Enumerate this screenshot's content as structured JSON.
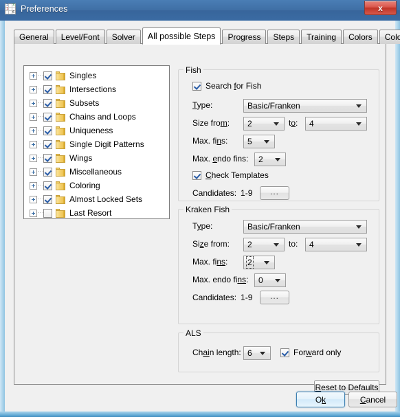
{
  "window": {
    "title": "Preferences",
    "icon": "sudoku-grid-icon",
    "close_label": "x",
    "titlebar_color": "#3f6fa5"
  },
  "tabs": [
    {
      "label": "General",
      "active": false
    },
    {
      "label": "Level/Font",
      "active": false
    },
    {
      "label": "Solver",
      "active": false
    },
    {
      "label": "All possible Steps",
      "active": true
    },
    {
      "label": "Progress",
      "active": false
    },
    {
      "label": "Steps",
      "active": false
    },
    {
      "label": "Training",
      "active": false
    },
    {
      "label": "Colors",
      "active": false
    },
    {
      "label": "ColorKu",
      "active": false
    }
  ],
  "tree": {
    "items": [
      {
        "label": "Singles",
        "checked": true,
        "expanded": false
      },
      {
        "label": "Intersections",
        "checked": true,
        "expanded": false
      },
      {
        "label": "Subsets",
        "checked": true,
        "expanded": false
      },
      {
        "label": "Chains and Loops",
        "checked": true,
        "expanded": false
      },
      {
        "label": "Uniqueness",
        "checked": true,
        "expanded": false
      },
      {
        "label": "Single Digit Patterns",
        "checked": true,
        "expanded": false
      },
      {
        "label": "Wings",
        "checked": true,
        "expanded": false
      },
      {
        "label": "Miscellaneous",
        "checked": true,
        "expanded": false
      },
      {
        "label": "Coloring",
        "checked": true,
        "expanded": false
      },
      {
        "label": "Almost Locked Sets",
        "checked": true,
        "expanded": false
      },
      {
        "label": "Last Resort",
        "checked": false,
        "expanded": false
      }
    ]
  },
  "fish": {
    "legend": "Fish",
    "search_label_pre": "Search ",
    "search_label_mnemonic": "f",
    "search_label_post": "or Fish",
    "search_checked": true,
    "type_label_pre": "",
    "type_label_mnemonic": "T",
    "type_label_post": "ype:",
    "type_value": "Basic/Franken",
    "size_label_pre": "Size fro",
    "size_label_mnemonic": "m",
    "size_label_post": ":",
    "size_from_value": "2",
    "to_label_pre": "t",
    "to_label_mnemonic": "o",
    "to_label_post": ":",
    "size_to_value": "4",
    "maxfins_label_pre": "Max. fi",
    "maxfins_label_mnemonic": "n",
    "maxfins_label_post": "s:",
    "maxfins_value": "5",
    "endofins_label_pre": "Max. ",
    "endofins_label_mnemonic": "e",
    "endofins_label_post": "ndo fins:",
    "endofins_value": "2",
    "templates_label_pre": "",
    "templates_label_mnemonic": "C",
    "templates_label_post": "heck Templates",
    "templates_checked": true,
    "candidates_label": "Candidates:",
    "candidates_value": "1-9",
    "candidates_button": "..."
  },
  "kraken": {
    "legend": "Kraken Fish",
    "type_label_pre": "T",
    "type_label_mnemonic": "y",
    "type_label_post": "pe:",
    "type_value": "Basic/Franken",
    "size_label_pre": "Si",
    "size_label_mnemonic": "z",
    "size_label_post": "e from:",
    "size_from_value": "2",
    "to_label": "to:",
    "size_to_value": "4",
    "maxfins_label_pre": "Max. fi",
    "maxfins_label_mnemonic": "ns",
    "maxfins_label_post": ":",
    "maxfins_value": "2",
    "maxfins_focused": true,
    "endofins_label_pre": "Max. endo fi",
    "endofins_label_mnemonic": "ns",
    "endofins_label_post": ":",
    "endofins_value": "0",
    "candidates_label": "Candidates:",
    "candidates_value": "1-9",
    "candidates_button": "..."
  },
  "als": {
    "legend": "ALS",
    "chain_label_pre": "Ch",
    "chain_label_mnemonic": "ai",
    "chain_label_post": "n length:",
    "chain_value": "6",
    "forward_label_pre": "For",
    "forward_label_mnemonic": "w",
    "forward_label_post": "ard only",
    "forward_checked": true
  },
  "buttons": {
    "reset_pre": "",
    "reset_mnemonic": "R",
    "reset_post": "eset to Defaults",
    "ok_pre": "O",
    "ok_mnemonic": "k",
    "ok_post": "",
    "cancel_pre": "",
    "cancel_mnemonic": "C",
    "cancel_post": "ancel"
  }
}
